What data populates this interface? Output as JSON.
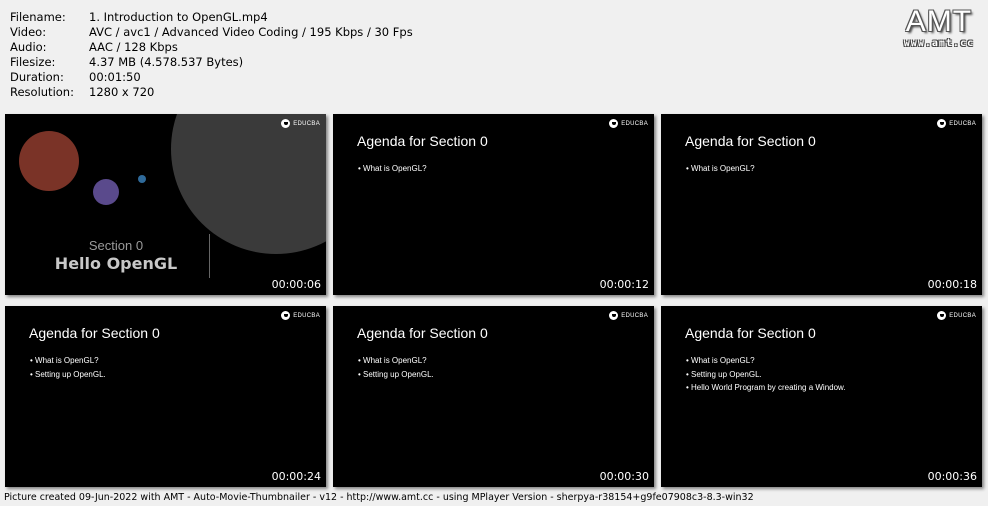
{
  "info": [
    {
      "key": "Filename:",
      "value": "1. Introduction to OpenGL.mp4"
    },
    {
      "key": "Video:",
      "value": "AVC / avc1 / Advanced Video Coding / 195 Kbps / 30 Fps"
    },
    {
      "key": "Audio:",
      "value": "AAC / 128 Kbps"
    },
    {
      "key": "Filesize:",
      "value": "4.37 MB (4.578.537 Bytes)"
    },
    {
      "key": "Duration:",
      "value": "00:01:50"
    },
    {
      "key": "Resolution:",
      "value": "1280 x 720"
    }
  ],
  "logo": {
    "text": "AMT",
    "url": "www.amt.cc"
  },
  "brand": "EDUCBA",
  "thumbnails": [
    {
      "timestamp": "00:00:06",
      "section_label": "Section 0",
      "section_title": "Hello OpenGL"
    },
    {
      "timestamp": "00:00:12",
      "title": "Agenda for Section 0",
      "bullets": [
        "• What is OpenGL?"
      ]
    },
    {
      "timestamp": "00:00:18",
      "title": "Agenda for Section 0",
      "bullets": [
        "• What is OpenGL?"
      ]
    },
    {
      "timestamp": "00:00:24",
      "title": "Agenda for Section 0",
      "bullets": [
        "• What is OpenGL?",
        "• Setting up OpenGL."
      ]
    },
    {
      "timestamp": "00:00:30",
      "title": "Agenda for Section 0",
      "bullets": [
        "• What is OpenGL?",
        "• Setting up OpenGL."
      ]
    },
    {
      "timestamp": "00:00:36",
      "title": "Agenda for Section 0",
      "bullets": [
        "• What is OpenGL?",
        "• Setting up OpenGL.",
        "• Hello World Program by creating a Window."
      ]
    }
  ],
  "colors": {
    "circle_large": "#7a3327",
    "circle_medium": "#5a4a8c",
    "circle_small": "#2f6a9a",
    "circle_gray": "#3a3a3a"
  },
  "footer": "Picture created 09-Jun-2022 with AMT - Auto-Movie-Thumbnailer - v12 - http://www.amt.cc - using MPlayer Version - sherpya-r38154+g9fe07908c3-8.3-win32"
}
